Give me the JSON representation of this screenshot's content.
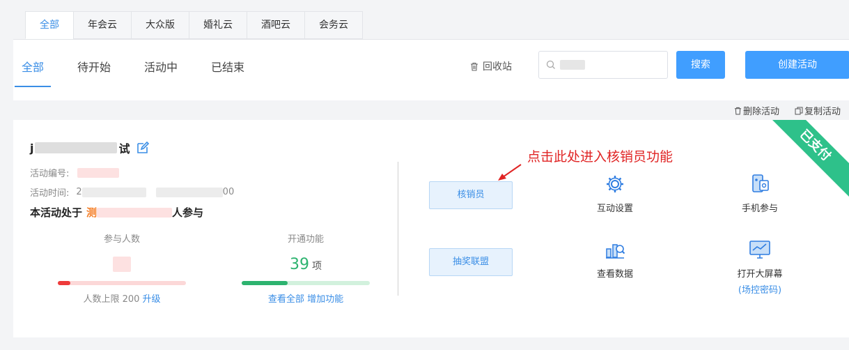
{
  "category_tabs": [
    "全部",
    "年会云",
    "大众版",
    "婚礼云",
    "酒吧云",
    "会务云"
  ],
  "status_tabs": [
    "全部",
    "待开始",
    "活动中",
    "已结束"
  ],
  "toolbar": {
    "recycle_label": "回收站",
    "search_button": "搜索",
    "create_button": "创建活动"
  },
  "card_actions": {
    "delete": "删除活动",
    "copy": "复制活动"
  },
  "card": {
    "badge": "已支付",
    "title_start": "j",
    "title_end": "试",
    "event_no_label": "活动编号:",
    "event_time_label": "活动时间:",
    "event_time_start": "2",
    "event_time_end": "00",
    "state_prefix": "本活动处于",
    "state_highlight": "测",
    "state_suffix": "人参与",
    "participants_label": "参与人数",
    "participant_limit_text": "人数上限 200",
    "upgrade_link": "升级",
    "features_label": "开通功能",
    "features_count": "39",
    "features_unit": "项",
    "view_all_link": "查看全部",
    "add_feature_link": "增加功能",
    "participants_progress": 0.1,
    "features_progress": 0.36
  },
  "actions": {
    "verifier_button": "核销员",
    "lottery_button": "抽奖联盟",
    "interactive_settings": "互动设置",
    "mobile_join": "手机参与",
    "view_data": "查看数据",
    "open_big_screen": "打开大屏幕",
    "venue_password": "(场控密码)"
  },
  "annotation": "点击此处进入核销员功能",
  "colors": {
    "accent": "#409eff",
    "paid_badge": "#2ec18a",
    "annotation": "#e02424"
  }
}
